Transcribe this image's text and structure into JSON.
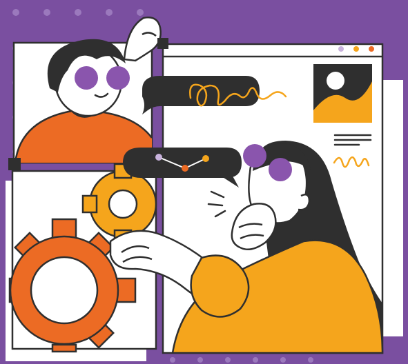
{
  "illustration": {
    "colors": {
      "background": "#7a4fa0",
      "panel": "#ffffff",
      "outline": "#2f2f2f",
      "orange": "#ec6b24",
      "yellow": "#f5a51c",
      "purple": "#8a55ad",
      "lavender": "#c9b3dd",
      "dot": "#9b79bd"
    },
    "window_controls": [
      "lavender-dot",
      "yellow-dot",
      "orange-dot"
    ]
  }
}
